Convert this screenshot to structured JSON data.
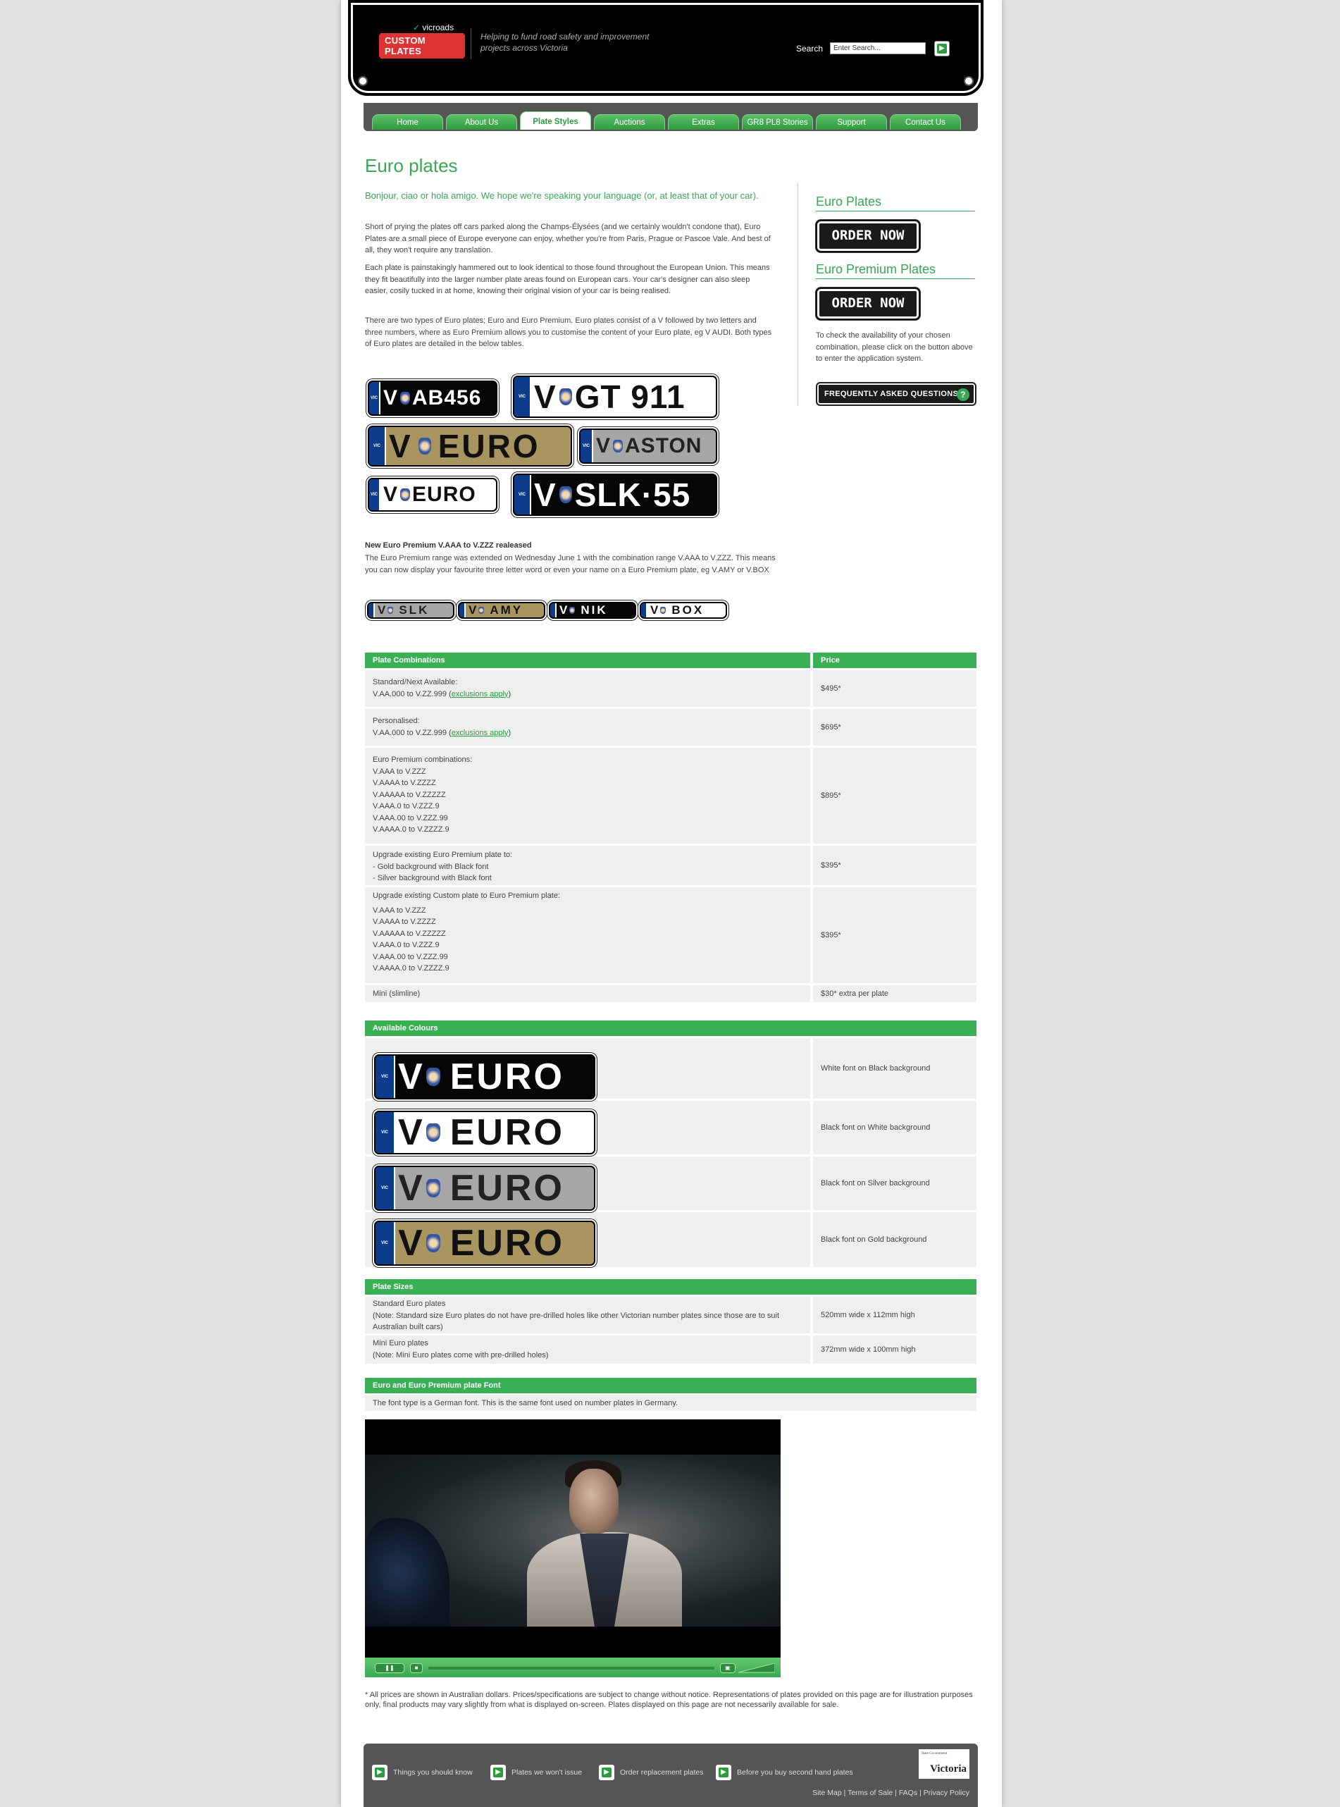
{
  "header": {
    "brand": "vicroads",
    "logo_label": "CUSTOM PLATES",
    "tagline": "Helping to fund road safety and improvement projects across Victoria",
    "search_label": "Search",
    "search_placeholder": "Enter Search..."
  },
  "nav": {
    "tabs": [
      {
        "label": "Home"
      },
      {
        "label": "About Us"
      },
      {
        "label": "Plate Styles"
      },
      {
        "label": "Auctions"
      },
      {
        "label": "Extras"
      },
      {
        "label": "GR8 PL8 Stories"
      },
      {
        "label": "Support"
      },
      {
        "label": "Contact Us"
      }
    ],
    "active": "Plate Styles"
  },
  "main": {
    "title": "Euro plates",
    "intro": "Bonjour, ciao or hola amigo. We hope we're speaking your language (or, at least that of your car).",
    "paragraphs": [
      "Short of prying the plates off cars parked along the Champs-Élysées (and we certainly wouldn't condone that), Euro Plates are a small piece of Europe everyone can enjoy, whether you're from Paris, Prague or Pascoe Vale. And best of all, they won't require any translation.",
      "Each plate is painstakingly hammered out to look identical to those found throughout the European Union. This means they fit beautifully into the larger number plate areas found on European cars. Your car's designer can also sleep easier, cosily tucked in at home, knowing their original vision of your car is being realised.",
      "There are two types of Euro plates; Euro and Euro Premium. Euro plates consist of a V followed by two letters and three numbers, where as Euro Premium allows you to customise the content of your Euro plate, eg V AUDI. Both types of Euro plates are detailed in the below tables."
    ],
    "plates": [
      {
        "text": "AB456",
        "style": "black"
      },
      {
        "text": "GT 911",
        "style": "white"
      },
      {
        "text": "EURO",
        "style": "gold"
      },
      {
        "text": "ASTON",
        "style": "silver"
      },
      {
        "text": "EURO",
        "style": "white"
      },
      {
        "text": "SLK·55",
        "style": "black"
      }
    ],
    "premium_heading": "New Euro Premium V.AAA to V.ZZZ realeased",
    "premium_text": "The Euro Premium range was extended on Wednesday June 1 with the combination range V.AAA to V.ZZZ. This means you can now display your favourite three letter word or even your name on a Euro Premium plate, eg V.AMY or V.BOX",
    "mini_plates": [
      {
        "text": "SLK",
        "style": "silver"
      },
      {
        "text": "AMY",
        "style": "gold"
      },
      {
        "text": "NIK",
        "style": "black"
      },
      {
        "text": "BOX",
        "style": "white"
      }
    ],
    "plate_prefix": "V",
    "vic_label": "VIC"
  },
  "sidebar": {
    "euro_heading": "Euro Plates",
    "order_label": "ORDER NOW",
    "premium_heading": "Euro Premium Plates",
    "help_text": "To check the availability of your chosen combination, please click on the button above to enter the application system.",
    "faq_label": "FREQUENTLY ASKED QUESTIONS",
    "faq_icon": "?"
  },
  "combinations": {
    "header_col1": "Plate Combinations",
    "header_col2": "Price",
    "rows": [
      {
        "lines": [
          "Standard/Next Available:",
          "V.AA.000 to V.ZZ.999"
        ],
        "link": "exclusions apply",
        "price": "$495*"
      },
      {
        "lines": [
          "Personalised:",
          "V.AA.000 to V.ZZ.999"
        ],
        "link": "exclusions apply",
        "price": "$695*"
      },
      {
        "lines": [
          "Euro Premium combinations:",
          "V.AAA to V.ZZZ",
          "V.AAAA to V.ZZZZ",
          "V.AAAAA to V.ZZZZZ",
          "V.AAA.0 to V.ZZZ.9",
          "V.AAA.00 to V.ZZZ.99",
          "V.AAAA.0 to V.ZZZZ.9"
        ],
        "price": "$895*"
      },
      {
        "lines": [
          "Upgrade existing Euro Premium plate to:",
          "- Gold background with Black font",
          "- Silver background with Black font"
        ],
        "price": "$395*"
      },
      {
        "lines": [
          "Upgrade existing Custom plate to Euro Premium plate:",
          "V.AAA to V.ZZZ",
          "V.AAAA to V.ZZZZ",
          "V.AAAAA to V.ZZZZZ",
          "V.AAA.0 to V.ZZZ.9",
          "V.AAA.00 to V.ZZZ.99",
          "V.AAAA.0 to V.ZZZZ.9"
        ],
        "price": "$395*"
      },
      {
        "lines": [
          "Mini (slimline)"
        ],
        "price": "$30* extra per plate"
      }
    ]
  },
  "colours": {
    "header": "Available Colours",
    "plate_text": "EURO",
    "rows": [
      {
        "style": "black",
        "label": "White font on Black background"
      },
      {
        "style": "white",
        "label": "Black font on White background"
      },
      {
        "style": "silver",
        "label": "Black font on Silver background"
      },
      {
        "style": "gold",
        "label": "Black font on Gold background"
      }
    ]
  },
  "sizes": {
    "header": "Plate Sizes",
    "rows": [
      {
        "lines": [
          "Standard Euro plates",
          "(Note: Standard size Euro plates do not have pre-drilled holes like other Victorian number plates since those are to suit Australian built cars)"
        ],
        "value": "520mm wide x 112mm high"
      },
      {
        "lines": [
          "Mini Euro plates",
          "(Note: Mini Euro plates come with pre-drilled holes)"
        ],
        "value": "372mm wide x 100mm high"
      }
    ]
  },
  "font_section": {
    "header": "Euro and Euro Premium plate Font",
    "text": "The font type is a German font. This is the same font used on number plates in Germany."
  },
  "video": {
    "play_icon": "pause-icon",
    "stop_icon": "stop-icon"
  },
  "footnote": "* All prices are shown in Australian dollars. Prices/specifications are subject to change without notice. Representations of plates provided on this page are for illustration purposes only, final products may vary slightly from what is displayed on-screen. Plates displayed on this page are not necessarily available for sale.",
  "footer": {
    "links": [
      {
        "label": "Things you should know"
      },
      {
        "label": "Plates we won't issue"
      },
      {
        "label": "Order replacement plates"
      },
      {
        "label": "Before you buy second hand plates"
      }
    ],
    "gov_logo": "Victoria",
    "gov_small": "State Government",
    "legal": "Site Map | Terms of Sale | FAQs | Privacy Policy"
  },
  "colors": {
    "accent_green": "#3ab055",
    "plate_blue": "#0d3c8c",
    "plate_gold": "#a99560",
    "plate_silver": "#a6a6a6"
  }
}
